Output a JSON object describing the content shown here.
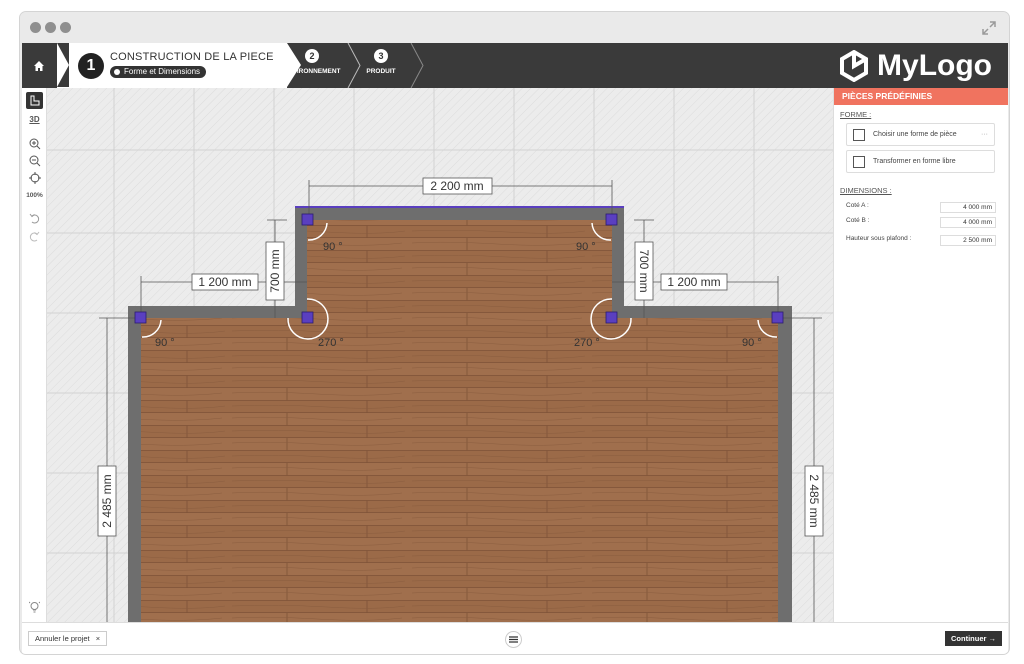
{
  "steps": [
    {
      "number": "1",
      "title": "CONSTRUCTION DE LA PIECE",
      "subtitle": "Forme et Dimensions"
    },
    {
      "number": "2",
      "title": "ENVIRONNEMENT"
    },
    {
      "number": "3",
      "title": "PRODUIT"
    }
  ],
  "logo": {
    "text": "MyLogo"
  },
  "toolbar": {
    "view_3d": "3D",
    "zoom_level": "100%"
  },
  "canvas": {
    "dimensions": {
      "top_width": "2 200 mm",
      "left_arm_width": "1 200 mm",
      "right_arm_width": "1 200 mm",
      "left_arm_height": "700 mm",
      "right_arm_height": "700 mm",
      "left_height": "2 485 mm",
      "right_height": "2 485 mm"
    },
    "angles": {
      "top_left": "90 °",
      "top_right": "90 °",
      "inner_left": "270 °",
      "inner_right": "270 °",
      "outer_left": "90 °",
      "outer_right": "90 °"
    }
  },
  "panel": {
    "header": "PIÈCES PRÉDÉFINIES",
    "forme_label": "FORME :",
    "choose_shape": "Choisir une forme de pièce",
    "choose_shape_more": "···",
    "free_shape": "Transformer en forme libre",
    "dimensions_label": "DIMENSIONS :",
    "rows": [
      {
        "label": "Coté A :",
        "value": "4 000 mm"
      },
      {
        "label": "Coté B :",
        "value": "4 000 mm"
      },
      {
        "label": "Hauteur sous plafond :",
        "value": "2 500 mm"
      }
    ]
  },
  "bottom": {
    "cancel_label": "Annuler le projet",
    "cancel_close": "×",
    "continue_label": "Continuer →"
  },
  "colors": {
    "accent": "#f0735f",
    "dark": "#3a3a3a",
    "wood": "#9b6a48",
    "handle": "#5a3fc0"
  }
}
